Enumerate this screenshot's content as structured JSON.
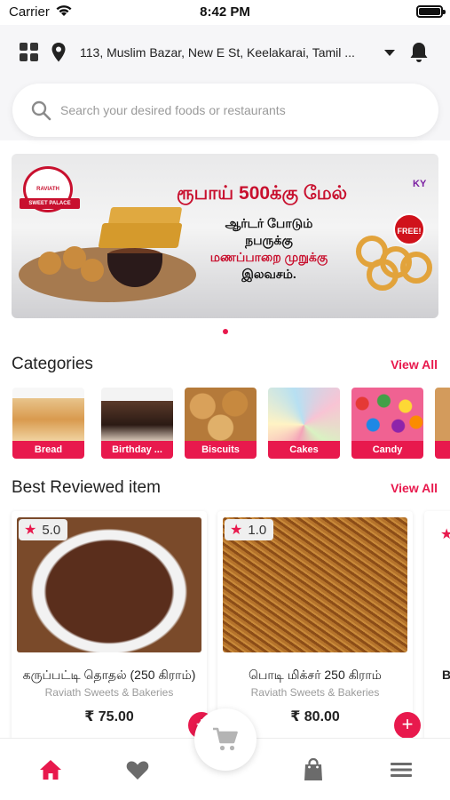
{
  "status_bar": {
    "carrier": "Carrier",
    "time": "8:42 PM"
  },
  "header": {
    "address": "113, Muslim Bazar, New E St, Keelakarai, Tamil ...",
    "search_placeholder": "Search your desired foods or restaurants"
  },
  "banner": {
    "brand": "RAVIATH",
    "brand_tagline": "SWEET PALACE",
    "headline": "ரூபாய் 500க்கு மேல்",
    "lines": [
      "ஆர்டர் போடும்",
      "நபருக்கு",
      "மணப்பாறை முறுக்கு",
      "இலவசம்."
    ],
    "free_badge": "FREE!",
    "corner_logo": "KY"
  },
  "categories": {
    "title": "Categories",
    "view_all": "View All",
    "items": [
      {
        "label": "Bread",
        "icon": "bread-image"
      },
      {
        "label": "Birthday ...",
        "icon": "birthday-cake-image"
      },
      {
        "label": "Biscuits",
        "icon": "biscuits-image"
      },
      {
        "label": "Cakes",
        "icon": "cakes-image"
      },
      {
        "label": "Candy",
        "icon": "candy-image"
      }
    ]
  },
  "best_reviewed": {
    "title": "Best Reviewed item",
    "view_all": "View All",
    "items": [
      {
        "rating": "5.0",
        "name": "கருப்பட்டி தொதல் (250 கிராம்)",
        "shop": "Raviath Sweets & Bakeries",
        "price": "₹ 75.00"
      },
      {
        "rating": "1.0",
        "name": "பொடி மிக்சர் 250 கிராம்",
        "shop": "Raviath Sweets & Bakeries",
        "price": "₹ 80.00"
      }
    ],
    "partial_initial": "B"
  },
  "bottom_nav": {
    "items": [
      "home-icon",
      "heart-icon",
      "cart-icon",
      "bag-icon",
      "menu-icon"
    ],
    "active_color": "#e8194d",
    "inactive_color": "#6b6b6b"
  },
  "colors": {
    "accent": "#e8194d"
  }
}
